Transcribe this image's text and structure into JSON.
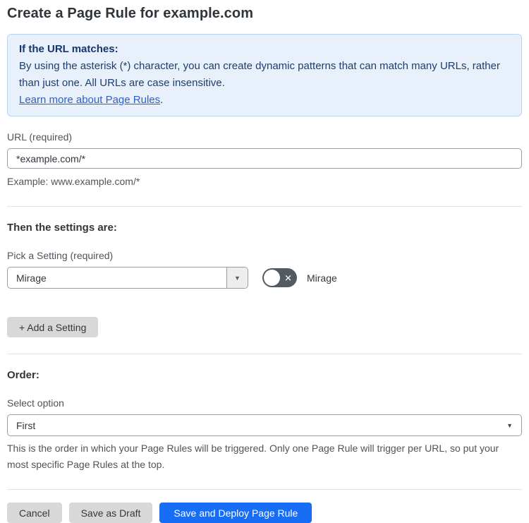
{
  "page": {
    "title": "Create a Page Rule for example.com"
  },
  "info_box": {
    "heading": "If the URL matches:",
    "body": "By using the asterisk (*) character, you can create dynamic patterns that can match many URLs, rather than just one. All URLs are case insensitive.",
    "link_label": "Learn more about Page Rules",
    "link_suffix": "."
  },
  "url_field": {
    "label": "URL (required)",
    "value": "*example.com/*",
    "helper": "Example: www.example.com/*"
  },
  "settings_section": {
    "heading": "Then the settings are:",
    "picker_label": "Pick a Setting (required)",
    "picker_value": "Mirage",
    "toggle_label": "Mirage",
    "toggle_state": "off",
    "toggle_icon": "✕",
    "chevron_icon": "▼",
    "add_setting_label": "+ Add a Setting"
  },
  "order_section": {
    "heading": "Order:",
    "select_label": "Select option",
    "select_value": "First",
    "chevron_icon": "▼",
    "helper": "This is the order in which your Page Rules will be triggered. Only one Page Rule will trigger per URL, so put your most specific Page Rules at the top."
  },
  "actions": {
    "cancel_label": "Cancel",
    "save_draft_label": "Save as Draft",
    "save_deploy_label": "Save and Deploy Page Rule"
  },
  "colors": {
    "info_bg": "#e8f1fb",
    "info_border": "#b9d3ef",
    "info_text": "#1d3d6f",
    "link_blue": "#2c5fc8",
    "primary_blue": "#186df5",
    "button_gray": "#d8d8d8",
    "toggle_gray": "#545a61"
  }
}
